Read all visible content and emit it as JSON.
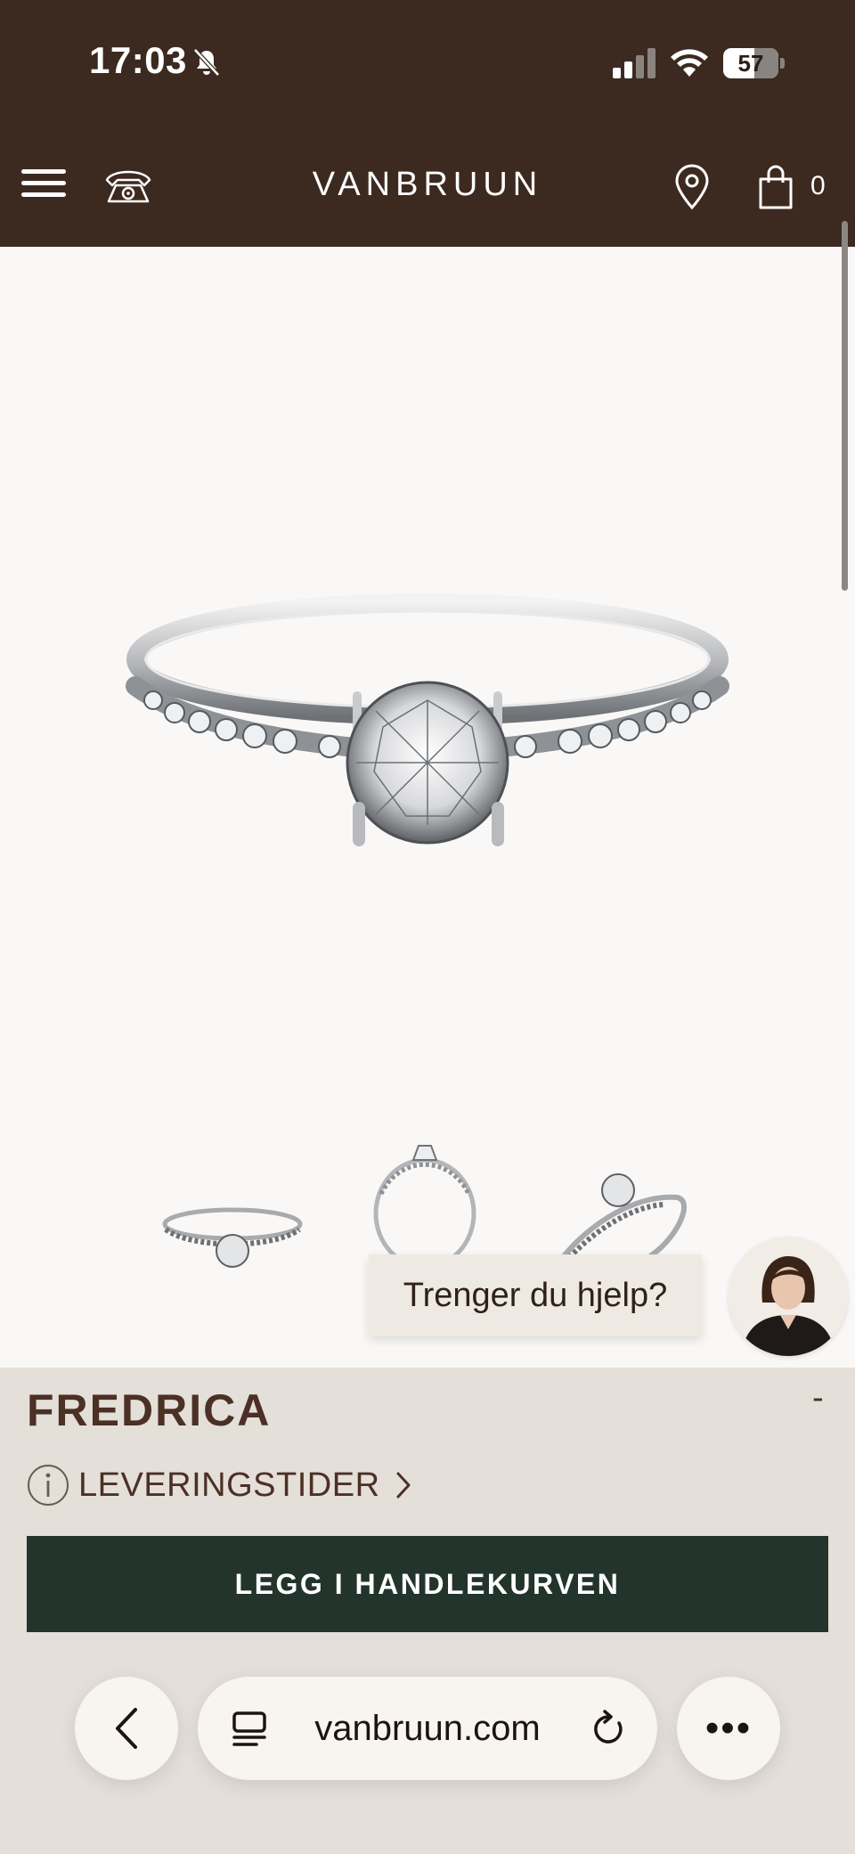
{
  "status_bar": {
    "time": "17:03",
    "battery": "57",
    "battery_level": 0.57
  },
  "header": {
    "brand": "VANBRUUN",
    "cart_count": "0",
    "background": "#3c2a21"
  },
  "product": {
    "name": "FREDRICA",
    "collapse_symbol": "-",
    "delivery_label": "LEVERINGSTIDER",
    "cart_button_label": "LEGG I HANDLEKURVEN",
    "button_color": "#22342b"
  },
  "help": {
    "label": "Trenger du hjelp?"
  },
  "browser": {
    "url": "vanbruun.com",
    "more_label": "•••"
  },
  "icons": [
    "menu-icon",
    "phone-icon",
    "location-pin-icon",
    "shopping-bag-icon",
    "info-icon",
    "chevron-right-icon",
    "chevron-left-icon",
    "reader-icon",
    "reload-icon",
    "bell-off-icon",
    "signal-icon",
    "wifi-icon",
    "battery-icon"
  ]
}
